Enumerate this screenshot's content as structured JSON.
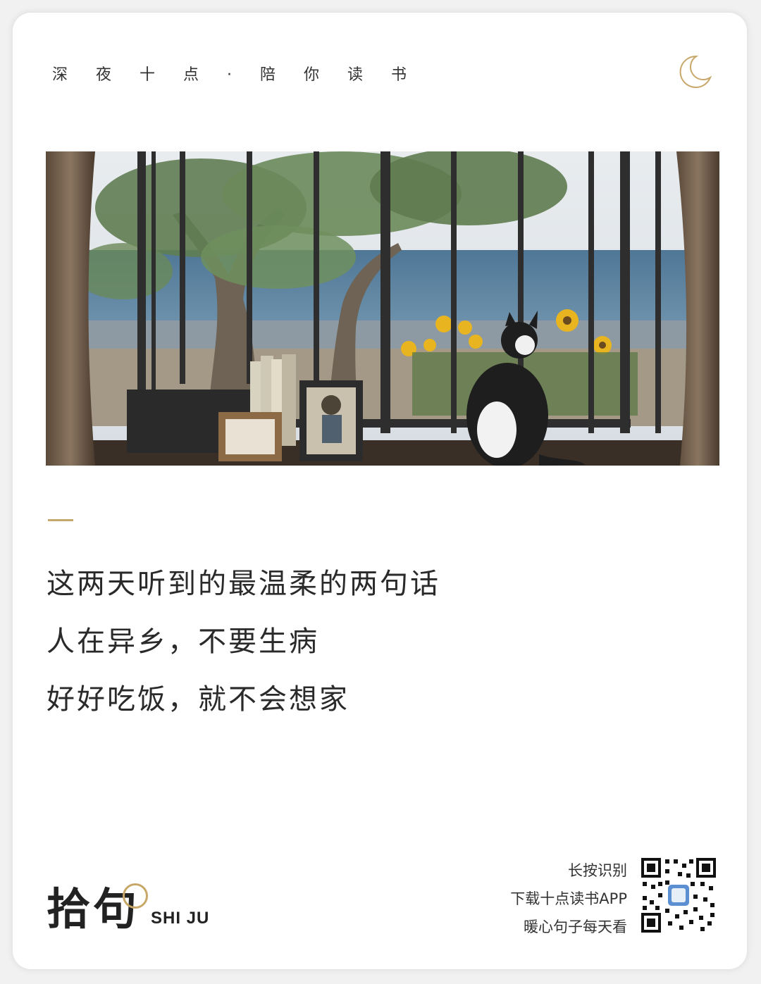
{
  "header": {
    "tagline": "深夜十点·陪你读书"
  },
  "photo": {
    "description_icon": "window-cat-photo"
  },
  "quote": {
    "lines": [
      "这两天听到的最温柔的两句话",
      "人在异乡，不要生病",
      "好好吃饭，就不会想家"
    ]
  },
  "footer": {
    "logo_cn": "拾句",
    "logo_en": "SHI JU",
    "promo": [
      "长按识别",
      "下载十点读书APP",
      "暖心句子每天看"
    ],
    "qr_icon": "qr-code-icon"
  },
  "colors": {
    "accent": "#c8a86a",
    "text": "#2a2a2a",
    "background": "#ffffff"
  }
}
